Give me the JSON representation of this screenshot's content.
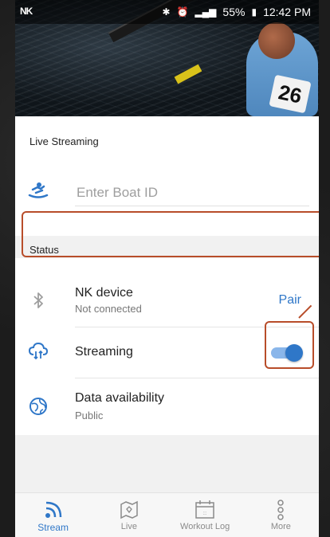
{
  "status_bar": {
    "carrier_logo": "NK",
    "battery": "55%",
    "time": "12:42 PM",
    "icons": [
      "bluetooth-icon",
      "alarm-icon",
      "signal-icon",
      "battery-icon"
    ]
  },
  "hero": {
    "bib_number": "26"
  },
  "live_streaming": {
    "section_label": "Live Streaming",
    "boat_id_placeholder": "Enter Boat ID"
  },
  "status": {
    "section_label": "Status",
    "rows": [
      {
        "title": "NK device",
        "subtitle": "Not connected",
        "action_label": "Pair",
        "icon": "bluetooth-icon"
      },
      {
        "title": "Streaming",
        "toggle_on": true,
        "icon": "cloud-sync-icon"
      },
      {
        "title": "Data availability",
        "subtitle": "Public",
        "icon": "globe-icon"
      }
    ]
  },
  "bottom_nav": {
    "items": [
      {
        "label": "Stream",
        "icon": "stream-icon",
        "active": true
      },
      {
        "label": "Live",
        "icon": "map-icon",
        "active": false
      },
      {
        "label": "Workout Log",
        "icon": "calendar-icon",
        "active": false
      },
      {
        "label": "More",
        "icon": "more-vertical-icon",
        "active": false
      }
    ]
  },
  "colors": {
    "accent": "#2f77c8",
    "highlight": "#b84d2a"
  }
}
